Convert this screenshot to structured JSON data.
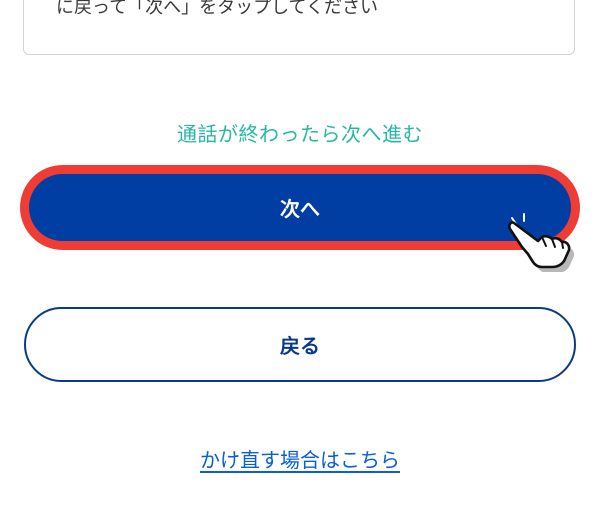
{
  "info_card": {
    "text": "に戻って「次へ」をタップしてください"
  },
  "hint": {
    "text": "通話が終わったら次へ進む",
    "color": "#27b8a4"
  },
  "next_button": {
    "label": "次へ",
    "highlighted": true,
    "highlight_color": "#ef3d36",
    "background_color": "#003ea3"
  },
  "pointer": {
    "icon": "tap-hand-icon"
  },
  "back_button": {
    "label": "戻る",
    "border_color": "#0a3a86"
  },
  "redial_link": {
    "label": "かけ直す場合はこちら",
    "color": "#0a5ed8"
  }
}
